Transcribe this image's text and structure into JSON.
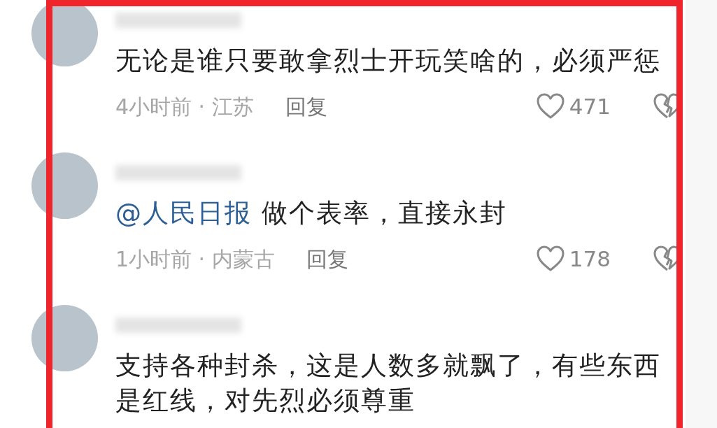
{
  "comments": [
    {
      "text": "无论是谁只要敢拿烈士开玩笑啥的，必须严惩",
      "time": "4小时前",
      "location": "江苏",
      "reply": "回复",
      "likes": "471"
    },
    {
      "mention": "@人民日报",
      "text": "做个表率，直接永封",
      "time": "1小时前",
      "location": "内蒙古",
      "reply": "回复",
      "likes": "178"
    },
    {
      "text": "支持各种封杀，这是人数多就飘了，有些东西是红线，对先烈必须尊重"
    }
  ],
  "separator": "·"
}
